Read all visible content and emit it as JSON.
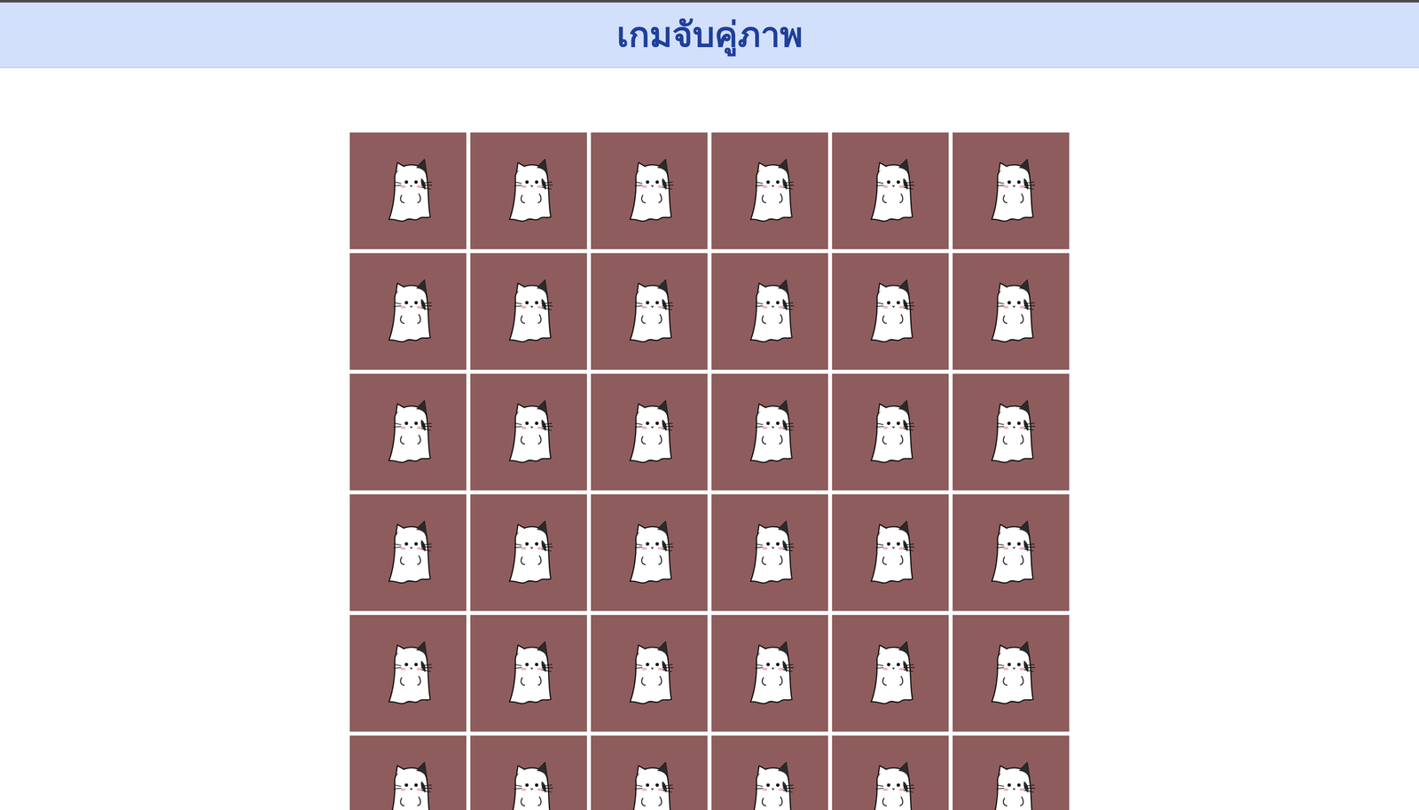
{
  "title": "เกมจับคู่ภาพ",
  "cards": [
    {
      "face_up": false
    },
    {
      "face_up": false
    },
    {
      "face_up": false
    },
    {
      "face_up": false
    },
    {
      "face_up": false
    },
    {
      "face_up": false
    },
    {
      "face_up": false
    },
    {
      "face_up": false
    },
    {
      "face_up": false
    },
    {
      "face_up": false
    },
    {
      "face_up": false
    },
    {
      "face_up": false
    },
    {
      "face_up": false
    },
    {
      "face_up": false
    },
    {
      "face_up": false
    },
    {
      "face_up": false
    },
    {
      "face_up": false
    },
    {
      "face_up": false
    },
    {
      "face_up": false
    },
    {
      "face_up": false
    },
    {
      "face_up": false
    },
    {
      "face_up": false
    },
    {
      "face_up": false
    },
    {
      "face_up": false
    },
    {
      "face_up": false
    },
    {
      "face_up": false
    },
    {
      "face_up": false
    },
    {
      "face_up": false
    },
    {
      "face_up": false
    },
    {
      "face_up": false
    },
    {
      "face_up": false
    },
    {
      "face_up": false
    },
    {
      "face_up": false
    },
    {
      "face_up": false
    },
    {
      "face_up": false
    },
    {
      "face_up": false
    }
  ]
}
